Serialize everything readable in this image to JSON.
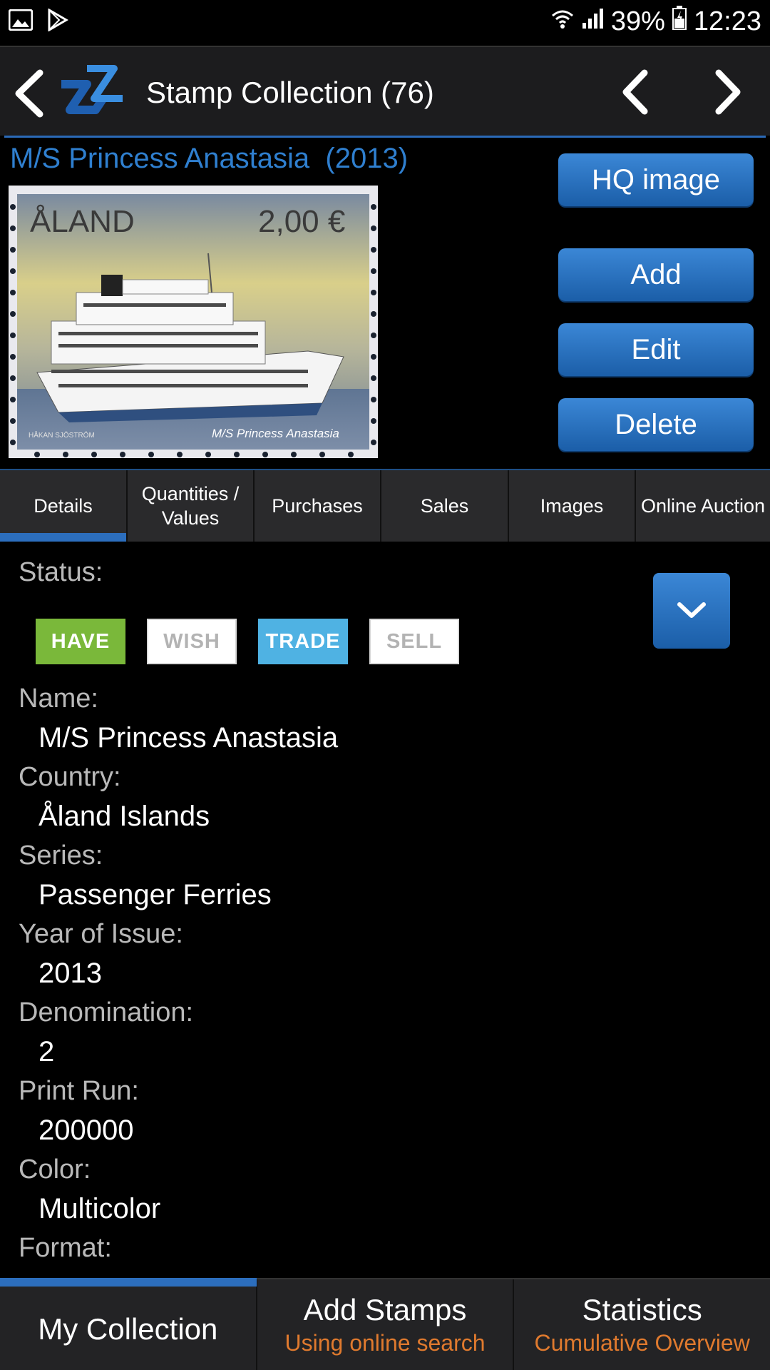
{
  "status_bar": {
    "battery": "39%",
    "time": "12:23"
  },
  "app_bar": {
    "title": "Stamp Collection (76)"
  },
  "stamp": {
    "title": "M/S Princess Anastasia  (2013)",
    "image_country_text": "ÅLAND",
    "image_value_text": "2,00 €",
    "image_caption": "M/S Princess Anastasia",
    "image_artist": "HÅKAN SJÖSTRÖM"
  },
  "actions": {
    "hq_image": "HQ image",
    "add": "Add",
    "edit": "Edit",
    "delete": "Delete"
  },
  "tabs": [
    {
      "label": "Details",
      "active": true
    },
    {
      "label": "Quantities / Values",
      "active": false
    },
    {
      "label": "Purchases",
      "active": false
    },
    {
      "label": "Sales",
      "active": false
    },
    {
      "label": "Images",
      "active": false
    },
    {
      "label": "Online Auction",
      "active": false
    }
  ],
  "details": {
    "status_label": "Status:",
    "chips": {
      "have": "HAVE",
      "wish": "WISH",
      "trade": "TRADE",
      "sell": "SELL"
    },
    "fields": [
      {
        "label": "Name:",
        "value": "M/S Princess Anastasia"
      },
      {
        "label": "Country:",
        "value": "Åland Islands"
      },
      {
        "label": "Series:",
        "value": "Passenger Ferries"
      },
      {
        "label": "Year of Issue:",
        "value": "2013"
      },
      {
        "label": "Denomination:",
        "value": "2"
      },
      {
        "label": "Print Run:",
        "value": "200000"
      },
      {
        "label": "Color:",
        "value": "Multicolor"
      },
      {
        "label": "Format:",
        "value": ""
      }
    ]
  },
  "bottom_nav": {
    "my_collection": "My Collection",
    "add_stamps": "Add Stamps",
    "add_stamps_sub": "Using online search",
    "statistics": "Statistics",
    "statistics_sub": "Cumulative Overview"
  },
  "colors": {
    "accent": "#2c6ebd",
    "title_blue": "#2f7fcf",
    "have_green": "#7ab83a",
    "trade_blue": "#4fb2e3",
    "sub_orange": "#e07a2e"
  }
}
